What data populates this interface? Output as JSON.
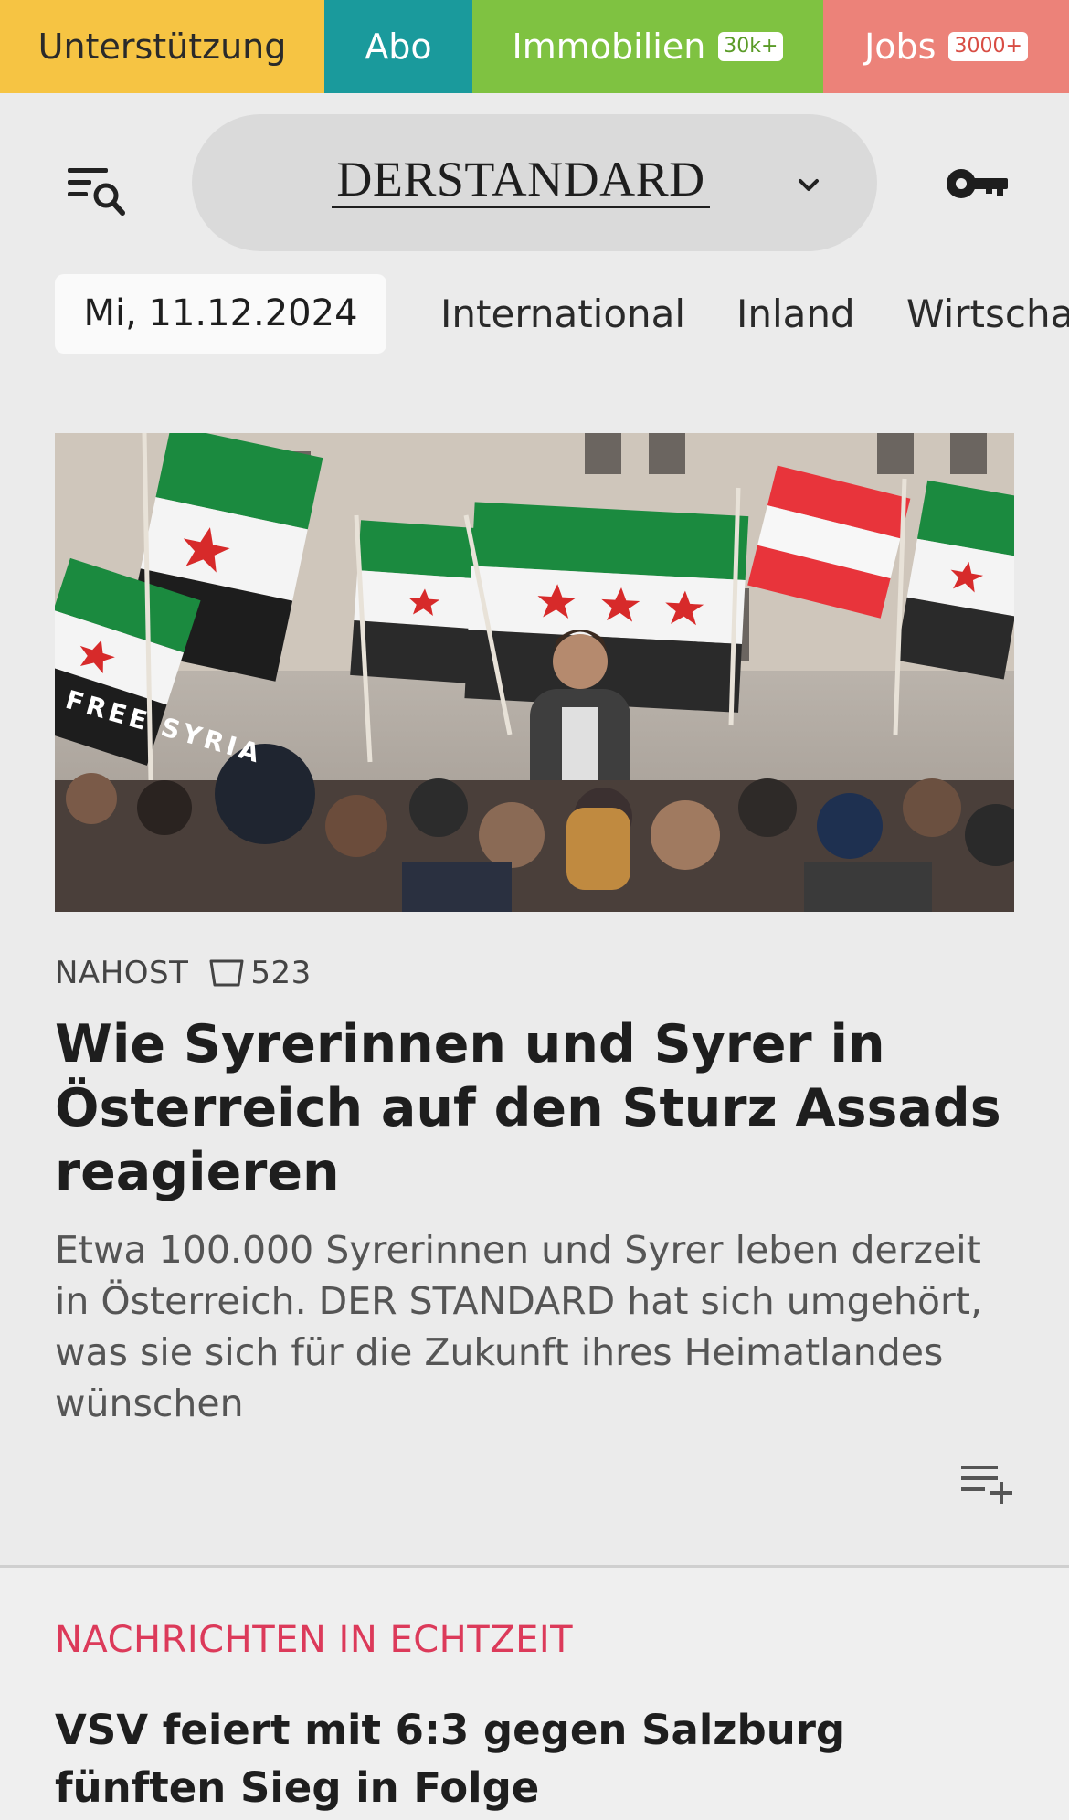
{
  "topbar": {
    "support": "Unterstützung",
    "abo": "Abo",
    "immobilien": "Immobilien",
    "immobilien_badge": "30k+",
    "jobs": "Jobs",
    "jobs_badge": "3000+"
  },
  "header": {
    "logo": "DERSTANDARD",
    "icons": [
      "menu-search-icon",
      "chevron-down-icon",
      "key-icon"
    ]
  },
  "nav": {
    "date": "Mi, 11.12.2024",
    "items": [
      "International",
      "Inland",
      "Wirtscha"
    ]
  },
  "article": {
    "kicker": "NAHOST",
    "comments": "523",
    "headline": "Wie Syrerinnen und Syrer in Österreich auf den Sturz Assads reagieren",
    "teaser": "Etwa 100.000 Syrerinnen und Syrer leben derzeit in Österreich. DER STANDARD hat sich umgehört, was sie sich für die Zukunft ihres Heimatlandes wünschen",
    "image_banner_text": "FREE SYRIA"
  },
  "live": {
    "label": "NACHRICHTEN IN ECHTZEIT",
    "headline": "VSV feiert mit 6:3 gegen Salzburg fünften Sieg in Folge"
  },
  "colors": {
    "support": "#f6c443",
    "abo": "#1a9a9c",
    "immobilien": "#7fc241",
    "jobs": "#ec8279",
    "live_label": "#dc3a5a",
    "background": "#ebebeb"
  }
}
